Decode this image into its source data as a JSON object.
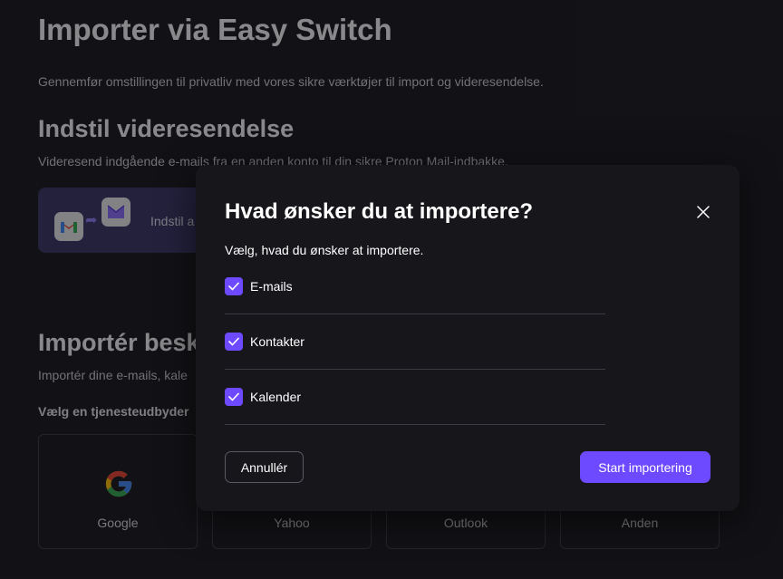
{
  "page": {
    "title": "Importer via Easy Switch",
    "description": "Gennemfør omstillingen til privatliv med vores sikre værktøjer til import og videresendelse.",
    "forward": {
      "title": "Indstil videresendelse",
      "description": "Videresend indgående e-mails fra en anden konto til din sikre Proton Mail-indbakke.",
      "card_label": "Indstil a"
    },
    "import": {
      "title": "Importér besk",
      "description": "Importér dine e-mails, kale",
      "provider_label": "Vælg en tjenesteudbyder",
      "providers": [
        {
          "name": "Google",
          "icon": "google-icon"
        },
        {
          "name": "Yahoo",
          "icon": "yahoo-icon"
        },
        {
          "name": "Outlook",
          "icon": "outlook-icon"
        },
        {
          "name": "Anden",
          "icon": "other-provider-icon"
        }
      ]
    }
  },
  "modal": {
    "title": "Hvad ønsker du at importere?",
    "subtitle": "Vælg, hvad du ønsker at importere.",
    "options": [
      {
        "label": "E-mails",
        "checked": true
      },
      {
        "label": "Kontakter",
        "checked": true
      },
      {
        "label": "Kalender",
        "checked": true
      }
    ],
    "cancel_label": "Annullér",
    "start_label": "Start importering",
    "close_icon": "close-icon"
  },
  "colors": {
    "accent": "#6d4aff",
    "background": "#1b1a20",
    "modal_background": "#17161b"
  }
}
